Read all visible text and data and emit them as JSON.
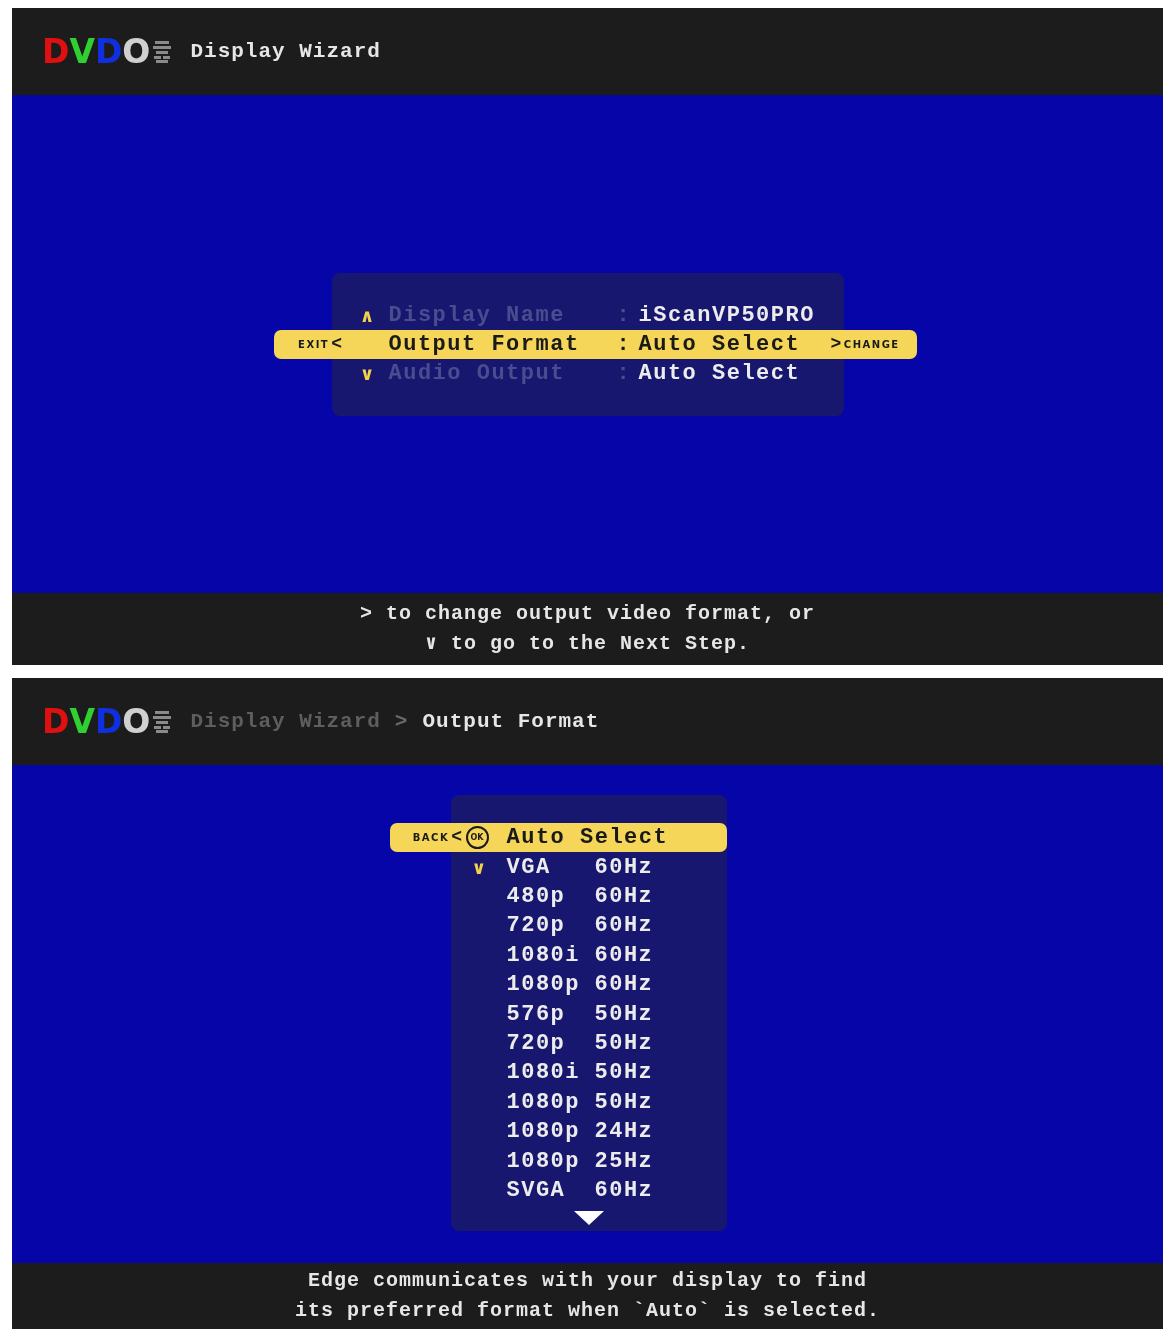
{
  "screens": [
    {
      "header": {
        "logo": [
          {
            "letter": "D",
            "color": "#e01010"
          },
          {
            "letter": "V",
            "color": "#30d030"
          },
          {
            "letter": "D",
            "color": "#1030e0"
          },
          {
            "letter": "O",
            "color": "#d0d0d0"
          }
        ],
        "breadcrumb": [
          {
            "text": "Display Wizard",
            "current": true
          }
        ]
      },
      "menu": {
        "kind": "settings",
        "left_hint": {
          "text": "EXIT",
          "arrow": "<"
        },
        "right_hint": {
          "text": "CHANGE",
          "arrow": ">"
        },
        "rows": [
          {
            "label": "Display Name",
            "separator": ":",
            "value": "iScanVP50PRO",
            "selected": false,
            "arrow": "∧"
          },
          {
            "label": "Output Format",
            "separator": ":",
            "value": "Auto Select",
            "selected": true
          },
          {
            "label": "Audio Output",
            "separator": ":",
            "value": "Auto Select",
            "selected": false,
            "arrow": "∨"
          }
        ]
      },
      "footer": [
        "> to change output video format, or",
        "∨ to go to the Next Step."
      ]
    },
    {
      "header": {
        "logo": [
          {
            "letter": "D",
            "color": "#e01010"
          },
          {
            "letter": "V",
            "color": "#30d030"
          },
          {
            "letter": "D",
            "color": "#1030e0"
          },
          {
            "letter": "O",
            "color": "#d0d0d0"
          }
        ],
        "breadcrumb": [
          {
            "text": "Display Wizard",
            "current": false
          },
          {
            "text": "Output Format",
            "current": true
          }
        ],
        "separator": ">"
      },
      "menu": {
        "kind": "list",
        "left_hint": {
          "text": "BACK",
          "arrow": "<",
          "ok": "OK"
        },
        "rows": [
          {
            "label": "Auto Select",
            "selected": true
          },
          {
            "label": "VGA",
            "rate": "60Hz",
            "selected": false,
            "arrow": "∨"
          },
          {
            "label": "480p",
            "rate": "60Hz",
            "selected": false
          },
          {
            "label": "720p",
            "rate": "60Hz",
            "selected": false
          },
          {
            "label": "1080i",
            "rate": "60Hz",
            "selected": false
          },
          {
            "label": "1080p",
            "rate": "60Hz",
            "selected": false
          },
          {
            "label": "576p",
            "rate": "50Hz",
            "selected": false
          },
          {
            "label": "720p",
            "rate": "50Hz",
            "selected": false
          },
          {
            "label": "1080i",
            "rate": "50Hz",
            "selected": false
          },
          {
            "label": "1080p",
            "rate": "50Hz",
            "selected": false
          },
          {
            "label": "1080p",
            "rate": "24Hz",
            "selected": false
          },
          {
            "label": "1080p",
            "rate": "25Hz",
            "selected": false
          },
          {
            "label": "SVGA",
            "rate": "60Hz",
            "selected": false
          }
        ],
        "more_below": true
      },
      "footer": [
        "Edge communicates with your display to find",
        "its preferred format when `Auto` is selected."
      ]
    }
  ]
}
